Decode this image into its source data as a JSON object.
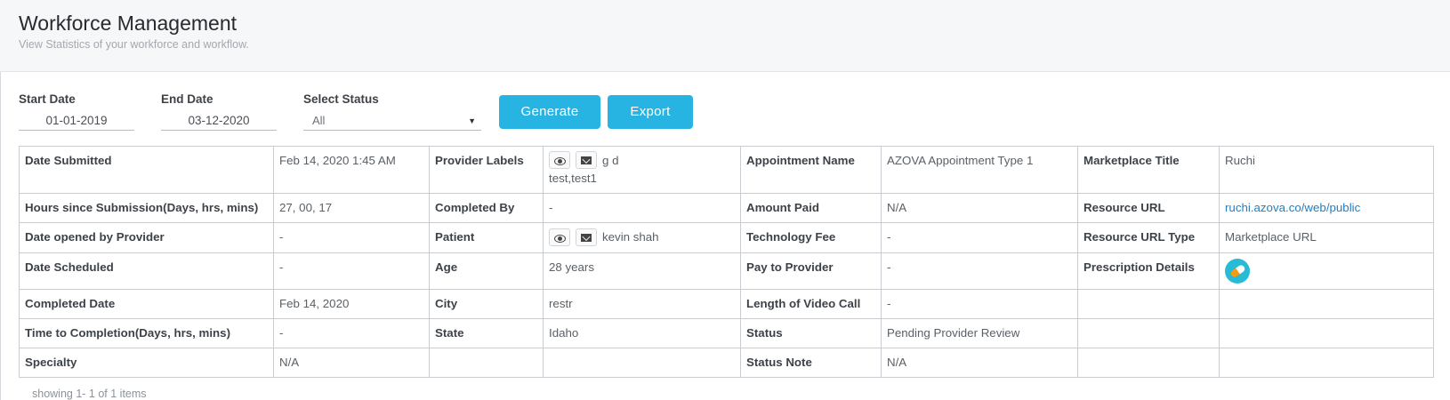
{
  "header": {
    "title": "Workforce Management",
    "subtitle": "View Statistics of your workforce and workflow."
  },
  "filters": {
    "start_date_label": "Start Date",
    "start_date_value": "01-01-2019",
    "end_date_label": "End Date",
    "end_date_value": "03-12-2020",
    "status_label": "Select Status",
    "status_value": "All",
    "generate_label": "Generate",
    "export_label": "Export"
  },
  "details": {
    "date_submitted_label": "Date Submitted",
    "date_submitted": "Feb 14, 2020 1:45 AM",
    "provider_labels_label": "Provider Labels",
    "provider_name": "g d",
    "provider_labels": "test,test1",
    "appointment_name_label": "Appointment Name",
    "appointment_name": "AZOVA Appointment Type 1",
    "marketplace_title_label": "Marketplace Title",
    "marketplace_title": "Ruchi",
    "hours_since_label": "Hours since Submission(Days, hrs, mins)",
    "hours_since": "27, 00, 17",
    "completed_by_label": "Completed By",
    "completed_by": "-",
    "amount_paid_label": "Amount Paid",
    "amount_paid": "N/A",
    "resource_url_label": "Resource URL",
    "resource_url": "ruchi.azova.co/web/public",
    "date_opened_label": "Date opened by Provider",
    "date_opened": "-",
    "patient_label": "Patient",
    "patient": "kevin shah",
    "technology_fee_label": "Technology Fee",
    "technology_fee": "-",
    "resource_url_type_label": "Resource URL Type",
    "resource_url_type": "Marketplace URL",
    "date_scheduled_label": "Date Scheduled",
    "date_scheduled": "-",
    "age_label": "Age",
    "age": "28 years",
    "pay_to_provider_label": "Pay to Provider",
    "pay_to_provider": "-",
    "prescription_details_label": "Prescription Details",
    "completed_date_label": "Completed Date",
    "completed_date": "Feb 14, 2020",
    "city_label": "City",
    "city": "restr",
    "video_call_length_label": "Length of Video Call",
    "video_call_length": "-",
    "time_to_completion_label": "Time to Completion(Days, hrs, mins)",
    "time_to_completion": "-",
    "state_label": "State",
    "state": "Idaho",
    "status_label": "Status",
    "status": "Pending Provider Review",
    "specialty_label": "Specialty",
    "specialty": "N/A",
    "status_note_label": "Status Note",
    "status_note": "N/A"
  },
  "icons": {
    "view": "eye-icon",
    "message": "envelope-icon",
    "prescription": "pill-icon"
  },
  "colors": {
    "accent": "#28b4e3",
    "link": "#1f7fc4",
    "prescription_icon": "#27bbd6"
  },
  "footer": {
    "pagination_text": "showing 1- 1 of 1 items"
  }
}
